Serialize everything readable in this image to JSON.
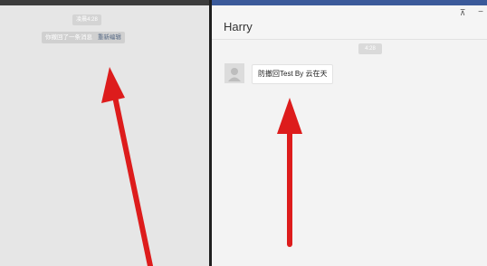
{
  "left_pane": {
    "time_label": "凌晨4:28",
    "recall_notice": "你撤回了一条消息",
    "re_edit_link": "重新编辑"
  },
  "right_pane": {
    "contact_name": "Harry",
    "time_label": "4:28",
    "message_text": "防撤回Test By 云在天",
    "pin_icon_glyph": "⊼",
    "minimize_icon_glyph": "−"
  },
  "colors": {
    "arrow_red": "#dd1c1c",
    "link_color": "#586b86",
    "title_bar_blue": "#3b5a9a"
  }
}
